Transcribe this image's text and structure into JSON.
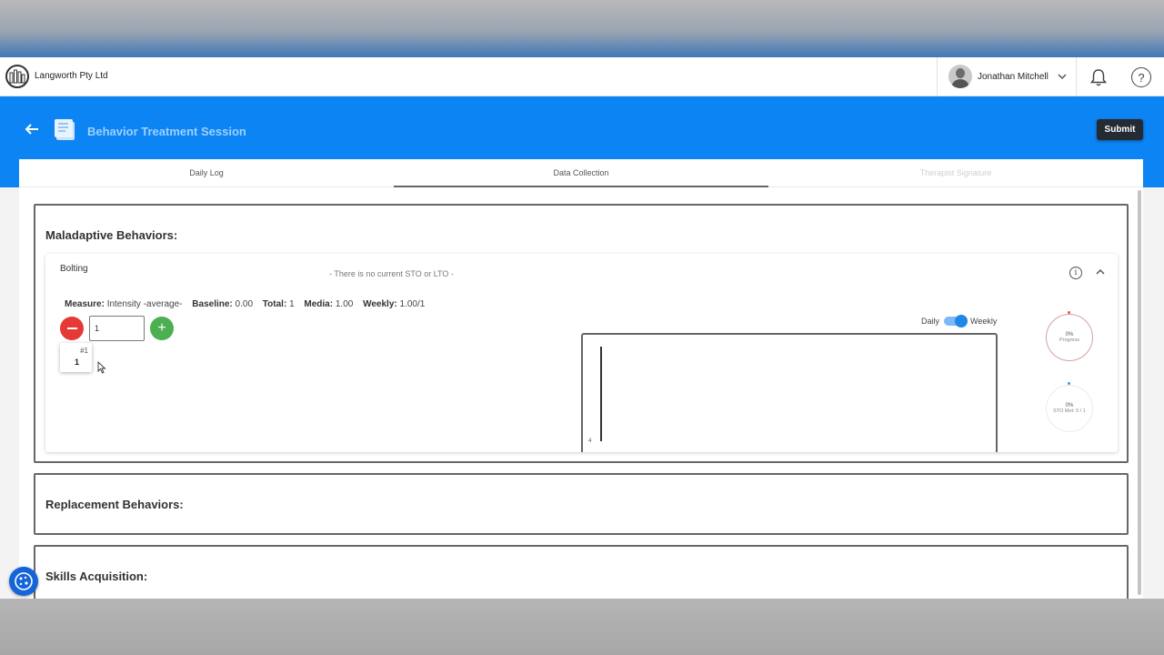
{
  "topnav": {
    "company": "Langworth Pty Ltd",
    "user_name": "Jonathan Mitchell",
    "help_symbol": "?"
  },
  "header": {
    "title": "Behavior Treatment Session",
    "submit_label": "Submit"
  },
  "tabs": [
    {
      "label": "Daily Log",
      "state": "normal"
    },
    {
      "label": "Data Collection",
      "state": "active"
    },
    {
      "label": "Therapist Signature",
      "state": "disabled"
    }
  ],
  "maladaptive": {
    "title": "Maladaptive Behaviors:",
    "behavior": {
      "name": "Bolting",
      "goal_status": "-   There is no current STO or LTO   -",
      "info_symbol": "i",
      "measure_label": "Measure:",
      "measure_value": "Intensity -average-",
      "baseline_label": "Baseline:",
      "baseline_value": "0.00",
      "total_label": "Total:",
      "total_value": "1",
      "media_label": "Media:",
      "media_value": "1.00",
      "weekly_label": "Weekly:",
      "weekly_value": "1.00/1",
      "count_value": "1",
      "plus_symbol": "+",
      "entry_number": "#1",
      "entry_value": "1",
      "toggle_left": "Daily",
      "toggle_right": "Weekly",
      "toggle_state": "Weekly",
      "chart_tick": "4",
      "progress_pct": "0%",
      "progress_label": "Progress",
      "sto_pct": "0%",
      "sto_label": "STO Met: 0 / 1"
    }
  },
  "replacement": {
    "title": "Replacement Behaviors:"
  },
  "skills": {
    "title": "Skills Acquisition:"
  },
  "colors": {
    "header_blue": "#0d84f3",
    "minus_red": "#e53935",
    "plus_green": "#4caf50",
    "submit_dark": "#252b33",
    "toggle_blue": "#1e88e5"
  },
  "icons": [
    "logo-icon",
    "chevron-down-icon",
    "bell-icon",
    "help-icon",
    "back-arrow-icon",
    "document-icon",
    "info-icon",
    "chevron-up-icon",
    "minus-icon",
    "plus-icon",
    "cursor-icon",
    "cookie-icon"
  ]
}
